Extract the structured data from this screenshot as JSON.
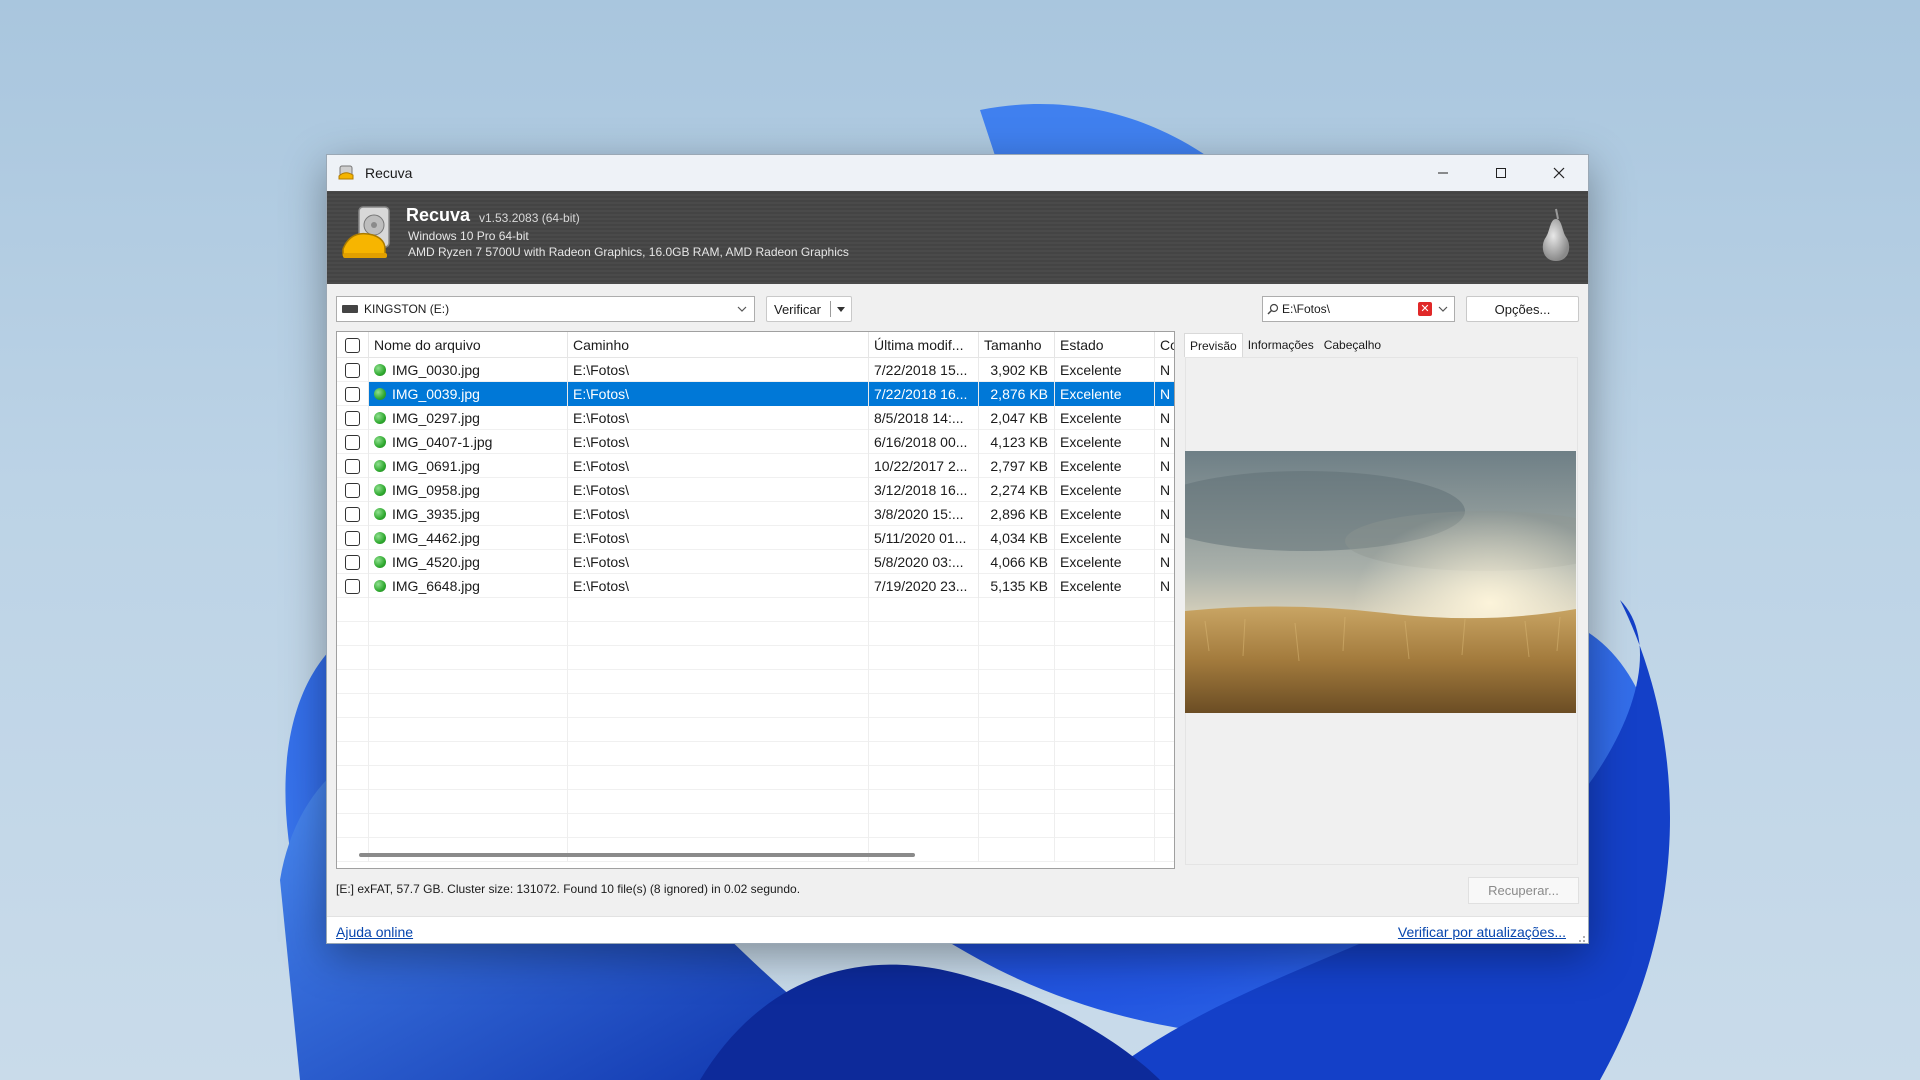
{
  "window": {
    "title": "Recuva",
    "controls": [
      "minimize-icon",
      "maximize-icon",
      "close-icon"
    ]
  },
  "banner": {
    "app_name": "Recuva",
    "version": "v1.53.2083 (64-bit)",
    "os": "Windows 10 Pro 64-bit",
    "hardware": "AMD Ryzen 7 5700U with Radeon Graphics, 16.0GB RAM, AMD Radeon Graphics"
  },
  "toolbar": {
    "drive": "KINGSTON (E:)",
    "verify_label": "Verificar",
    "filter_value": "E:\\Fotos\\",
    "options_label": "Opções..."
  },
  "columns": [
    "Nome do arquivo",
    "Caminho",
    "Última modif...",
    "Tamanho",
    "Estado",
    "Co"
  ],
  "files": [
    {
      "name": "IMG_0030.jpg",
      "path": "E:\\Fotos\\",
      "modified": "7/22/2018 15...",
      "size": "3,902 KB",
      "state": "Excelente",
      "comment": "N"
    },
    {
      "name": "IMG_0039.jpg",
      "path": "E:\\Fotos\\",
      "modified": "7/22/2018 16...",
      "size": "2,876 KB",
      "state": "Excelente",
      "comment": "N"
    },
    {
      "name": "IMG_0297.jpg",
      "path": "E:\\Fotos\\",
      "modified": "8/5/2018 14:...",
      "size": "2,047 KB",
      "state": "Excelente",
      "comment": "N"
    },
    {
      "name": "IMG_0407-1.jpg",
      "path": "E:\\Fotos\\",
      "modified": "6/16/2018 00...",
      "size": "4,123 KB",
      "state": "Excelente",
      "comment": "N"
    },
    {
      "name": "IMG_0691.jpg",
      "path": "E:\\Fotos\\",
      "modified": "10/22/2017 2...",
      "size": "2,797 KB",
      "state": "Excelente",
      "comment": "N"
    },
    {
      "name": "IMG_0958.jpg",
      "path": "E:\\Fotos\\",
      "modified": "3/12/2018 16...",
      "size": "2,274 KB",
      "state": "Excelente",
      "comment": "N"
    },
    {
      "name": "IMG_3935.jpg",
      "path": "E:\\Fotos\\",
      "modified": "3/8/2020 15:...",
      "size": "2,896 KB",
      "state": "Excelente",
      "comment": "N"
    },
    {
      "name": "IMG_4462.jpg",
      "path": "E:\\Fotos\\",
      "modified": "5/11/2020 01...",
      "size": "4,034 KB",
      "state": "Excelente",
      "comment": "N"
    },
    {
      "name": "IMG_4520.jpg",
      "path": "E:\\Fotos\\",
      "modified": "5/8/2020 03:...",
      "size": "4,066 KB",
      "state": "Excelente",
      "comment": "N"
    },
    {
      "name": "IMG_6648.jpg",
      "path": "E:\\Fotos\\",
      "modified": "7/19/2020 23...",
      "size": "5,135 KB",
      "state": "Excelente",
      "comment": "N"
    }
  ],
  "selected_index": 1,
  "preview": {
    "tabs": [
      "Previsão",
      "Informações",
      "Cabeçalho"
    ],
    "active_tab": 0
  },
  "status": {
    "text": "[E:] exFAT, 57.7 GB. Cluster size: 131072. Found 10 file(s) (8 ignored) in 0.02 segundo.",
    "recover_label": "Recuperar..."
  },
  "footer": {
    "help_link": "Ajuda online",
    "update_link": "Verificar por atualizações..."
  },
  "colors": {
    "selection": "#0078d7",
    "status_dot": "#2fa92f",
    "link": "#0645ad"
  }
}
